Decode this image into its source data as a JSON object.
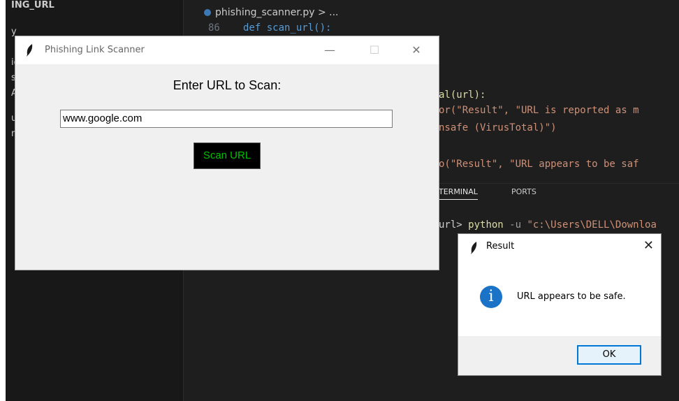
{
  "editor": {
    "sidebar_title": "ING_URL",
    "sidebar_items": [
      "y",
      "ig",
      "sh",
      "AD",
      "ui",
      "n_"
    ],
    "tab_label": "phishing_scanner.py > ...",
    "line_number": "86",
    "code_def": "def scan_url():",
    "code_line_1": "al(url):",
    "code_line_2": "or(\"Result\", \"URL is reported as m",
    "code_line_3": "nsafe (VirusTotal)\")",
    "code_line_4": "o(\"Result\", \"URL appears to be saf",
    "terminal_tab": "TERMINAL",
    "ports_tab": "PORTS",
    "terminal_line_prefix": "url> ",
    "terminal_cmd": "python",
    "terminal_flag": " -u ",
    "terminal_path": "\"c:\\Users\\DELL\\Downloa"
  },
  "tk_window": {
    "title": "Phishing Link Scanner",
    "minimize": "—",
    "maximize": "☐",
    "close": "✕",
    "prompt": "Enter URL to Scan:",
    "url_value": "www.google.com",
    "scan_button": "Scan URL"
  },
  "dialog": {
    "title": "Result",
    "close": "✕",
    "message": "URL appears to be safe.",
    "ok_button": "OK",
    "icon_glyph": "i"
  },
  "colors": {
    "scan_button_text": "#00c000",
    "info_icon": "#1a73c7",
    "ok_focus": "#0078d7"
  }
}
